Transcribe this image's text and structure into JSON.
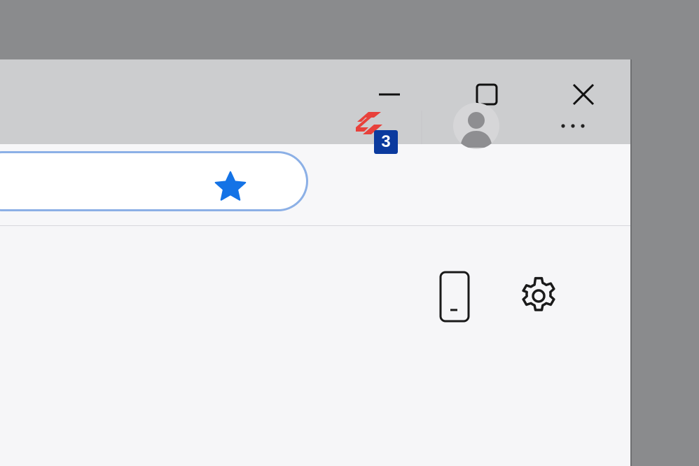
{
  "titlebar": {
    "minimize_icon": "minimize-icon",
    "maximize_icon": "maximize-icon",
    "close_icon": "close-icon"
  },
  "toolbar": {
    "address_value": "",
    "favorite_icon": "star-icon",
    "extension": {
      "icon": "extension-logo-icon",
      "badge_count": "3"
    },
    "profile_icon": "avatar-icon",
    "more_icon": "more-dots-icon"
  },
  "content": {
    "phone_icon": "phone-icon",
    "settings_icon": "gear-icon"
  },
  "colors": {
    "titlebar_bg": "#cccdcf",
    "toolbar_bg": "#f7f7f9",
    "address_border": "#8cb0e6",
    "star_blue": "#1473e6",
    "extension_red": "#e8413b",
    "badge_blue": "#0b3a9e",
    "desktop_gray": "#8a8b8d"
  }
}
